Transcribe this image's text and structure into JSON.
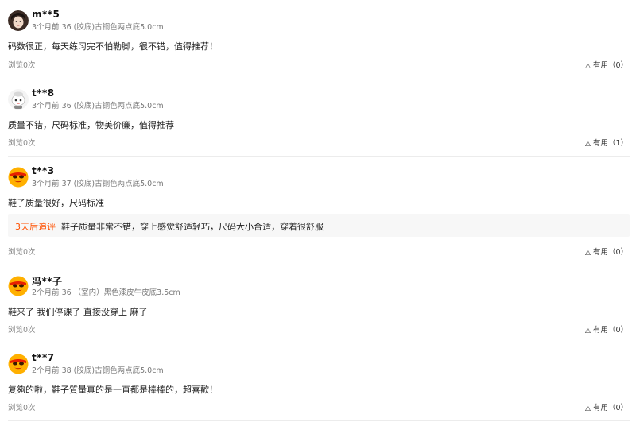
{
  "reviews": [
    {
      "user": "m**5",
      "avatar": "girl-photo-avatar",
      "meta": "3个月前 36 (胶底)古铜色两点底5.0cm",
      "content": "码数很正，每天练习完不怕勒脚，很不错，值得推荐！",
      "views": "浏览0次",
      "helpful": "有用（0）"
    },
    {
      "user": "t**8",
      "avatar": "white-cartoon-avatar",
      "meta": "3个月前 36 (胶底)古铜色两点底5.0cm",
      "content": "质量不错，尺码标准，物美价廉，值得推荐",
      "views": "浏览0次",
      "helpful": "有用（1）"
    },
    {
      "user": "t**3",
      "avatar": "orange-mascot-avatar",
      "meta": "3个月前 37 (胶底)古铜色两点底5.0cm",
      "content": "鞋子质量很好，尺码标准",
      "followup_tag": "3天后追评",
      "followup_text": "鞋子质量非常不错，穿上感觉舒适轻巧，尺码大小合适，穿着很舒服",
      "views": "浏览0次",
      "helpful": "有用（0）"
    },
    {
      "user": "冯**子",
      "avatar": "orange-mascot-avatar",
      "meta": "2个月前 36 （室内）黑色漆皮牛皮底3.5cm",
      "content": "鞋来了 我们停课了 直接没穿上 麻了",
      "views": "浏览0次",
      "helpful": "有用（0）"
    },
    {
      "user": "t**7",
      "avatar": "orange-mascot-avatar",
      "meta": "2个月前 38 (胶底)古铜色两点底5.0cm",
      "content": "复夠的啦，鞋子質量真的是一直都是棒棒的，超喜歡！",
      "views": "浏览0次",
      "helpful": "有用（0）"
    }
  ],
  "icons": {
    "helpful": "triangle-up-icon"
  }
}
